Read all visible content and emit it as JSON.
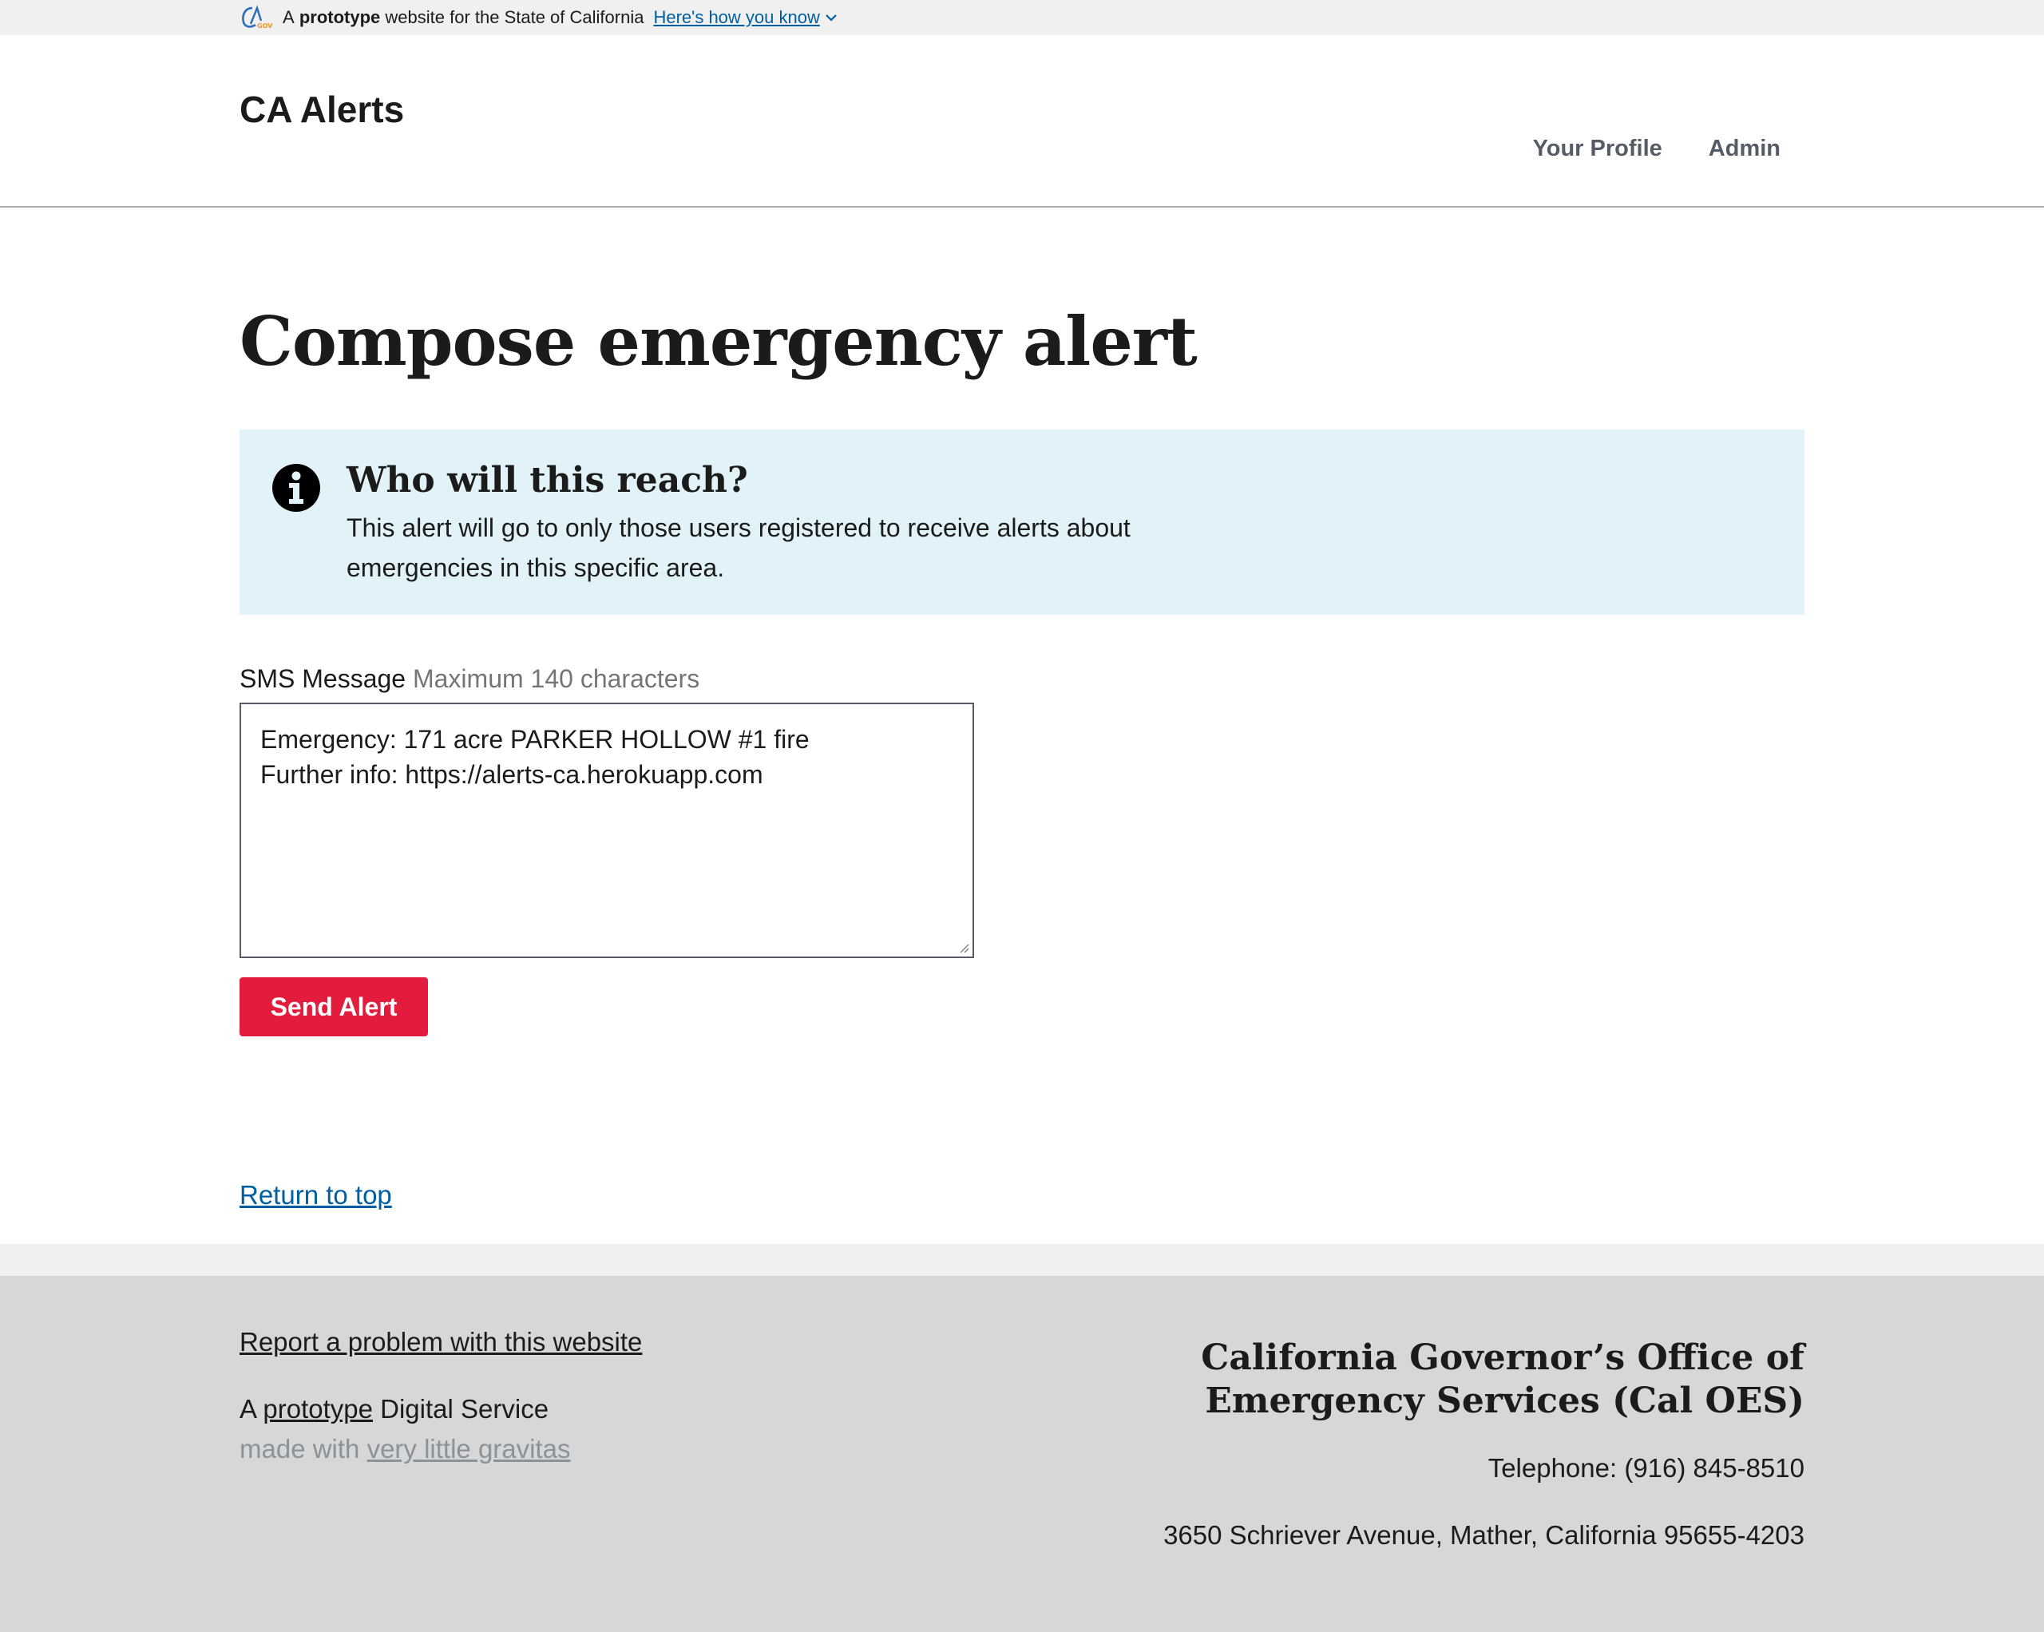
{
  "gov_banner": {
    "prefix": "A",
    "bold_word": "prototype",
    "suffix": "website for the State of California",
    "how_link": "Here's how you know"
  },
  "header": {
    "site_title": "CA Alerts",
    "nav": [
      {
        "label": "Your Profile"
      },
      {
        "label": "Admin"
      }
    ]
  },
  "main": {
    "page_title": "Compose emergency alert",
    "alert": {
      "heading": "Who will this reach?",
      "body": "This alert will go to only those users registered to receive alerts about emergencies in this specific area."
    },
    "sms": {
      "label": "SMS Message",
      "hint": "Maximum 140 characters",
      "line1": "Emergency: 171 acre PARKER HOLLOW #1 fire",
      "line2": "Further info: https://alerts-ca.herokuapp.com"
    },
    "send_button": "Send Alert",
    "return_to_top": "Return to top"
  },
  "footer": {
    "report_link": "Report a problem with this website",
    "proto_prefix": "A",
    "proto_link": "prototype",
    "proto_suffix": "Digital Service",
    "made_prefix": "made with",
    "made_link": "very little gravitas",
    "agency_line1": "California Governor’s Office of",
    "agency_line2": "Emergency Services (Cal OES)",
    "telephone": "Telephone: (916) 845-8510",
    "address": "3650 Schriever Avenue, Mather, California 95655-4203"
  },
  "colors": {
    "primary_link": "#005ea2",
    "send_button": "#e31c3d",
    "info_bg": "#e1f3f8",
    "footer_bg": "#d6d7d9"
  }
}
